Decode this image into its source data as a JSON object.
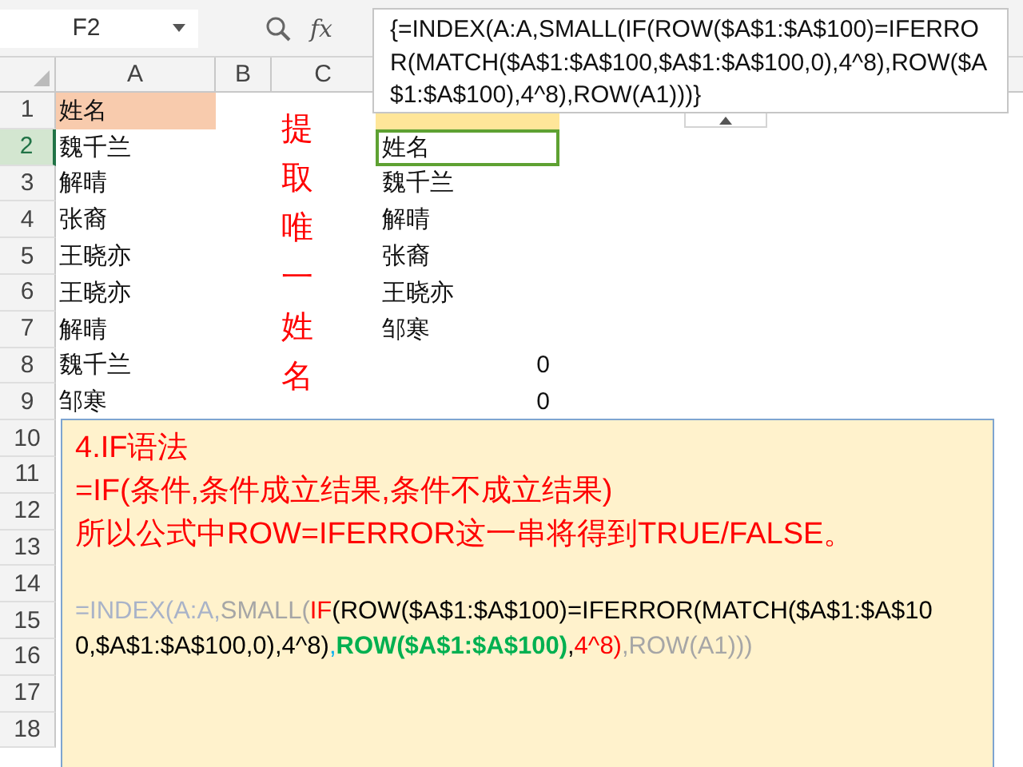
{
  "name_box": {
    "value": "F2"
  },
  "formula_bar": {
    "fx": "fx",
    "text": "{=INDEX(A:A,SMALL(IF(ROW($A$1:$A$100)=IFERROR(MATCH($A$1:$A$100,$A$1:$A$100,0),4^8),ROW($A$1:$A$100),4^8),ROW(A1)))}"
  },
  "columns": [
    {
      "label": "A",
      "selected": false
    },
    {
      "label": "B",
      "selected": false
    },
    {
      "label": "C",
      "selected": false
    }
  ],
  "rows": [
    {
      "number": "1",
      "selected": false,
      "kind": "header",
      "a": "姓名"
    },
    {
      "number": "2",
      "selected": true,
      "kind": "data",
      "a": "魏千兰",
      "f": "姓名"
    },
    {
      "number": "3",
      "selected": false,
      "kind": "data",
      "a": "解晴",
      "f": "魏千兰"
    },
    {
      "number": "4",
      "selected": false,
      "kind": "data",
      "a": "张裔",
      "f": "解晴"
    },
    {
      "number": "5",
      "selected": false,
      "kind": "data",
      "a": "王晓亦",
      "f": "张裔"
    },
    {
      "number": "6",
      "selected": false,
      "kind": "data",
      "a": "王晓亦",
      "f": "王晓亦"
    },
    {
      "number": "7",
      "selected": false,
      "kind": "data",
      "a": "解晴",
      "f": "邹寒"
    },
    {
      "number": "8",
      "selected": false,
      "kind": "number",
      "a": "魏千兰",
      "f": "0"
    },
    {
      "number": "9",
      "selected": false,
      "kind": "number",
      "a": "邹寒",
      "f": "0"
    },
    {
      "number": "10",
      "selected": false,
      "kind": "empty"
    },
    {
      "number": "11",
      "selected": false,
      "kind": "empty"
    },
    {
      "number": "12",
      "selected": false,
      "kind": "empty"
    },
    {
      "number": "13",
      "selected": false,
      "kind": "empty"
    },
    {
      "number": "14",
      "selected": false,
      "kind": "empty"
    },
    {
      "number": "15",
      "selected": false,
      "kind": "empty"
    },
    {
      "number": "16",
      "selected": false,
      "kind": "empty"
    },
    {
      "number": "17",
      "selected": false,
      "kind": "empty"
    },
    {
      "number": "18",
      "selected": false,
      "kind": "empty"
    }
  ],
  "side_note": "提取唯一姓名",
  "text_box": {
    "lines": [
      "4.IF语法",
      "=IF(条件,条件成立结果,条件不成立结果)",
      "所以公式中ROW=IFERROR这一串将得到TRUE/FALSE。"
    ],
    "formula_segments": [
      {
        "text": "=INDEX(A:A,",
        "color": "#a9b3c8",
        "bold": false
      },
      {
        "text": "SMALL(",
        "color": "#a6a6a6",
        "bold": false
      },
      {
        "text": "IF",
        "color": "#ff0000",
        "bold": false
      },
      {
        "text": "(ROW($A$1:$A$100)=IFERROR(MATCH($A$1:$A$100,$A$1:$A$100,0),4^8)",
        "color": "#000000",
        "bold": false
      },
      {
        "text": ",",
        "color": "#00b0f0",
        "bold": false
      },
      {
        "text": "ROW($A$1:$A$100)",
        "color": "#00b050",
        "bold": true
      },
      {
        "text": ",",
        "color": "#000000",
        "bold": false
      },
      {
        "text": "4^8)",
        "color": "#ff0000",
        "bold": false
      },
      {
        "text": ",ROW(A1)))",
        "color": "#a6a6a6",
        "bold": false
      }
    ]
  }
}
